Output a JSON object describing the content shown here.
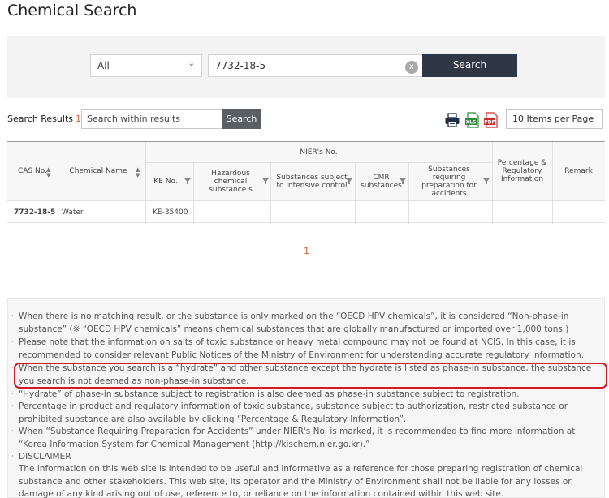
{
  "page": {
    "title": "Chemical Search"
  },
  "search": {
    "category_value": "All",
    "query_value": "7732-18-5",
    "clear_label": "x",
    "button_label": "Search"
  },
  "results": {
    "label": "Search Results",
    "count": "1",
    "within_placeholder": "Search within results",
    "within_button": "Search",
    "per_page": "10 Items per Page",
    "export": {
      "print": "print-icon",
      "excel": "XLS",
      "pdf": "PDF"
    }
  },
  "table": {
    "group_header": "NIER's No.",
    "headers": {
      "cas": "CAS No.",
      "name": "Chemical Name",
      "ke": "KE No.",
      "hazardous": "Hazardous chemical substance s",
      "intensive": "Substances subject to intensive control",
      "cmr": "CMR substances",
      "accidents": "Substances requiring preparation for accidents",
      "percentage": "Percentage & Regulatory Information",
      "remark": "Remark"
    },
    "rows": [
      {
        "cas": "7732-18-5",
        "name": "Water",
        "ke": "KE-35400"
      }
    ]
  },
  "pagination": {
    "current": "1"
  },
  "notices": [
    "When there is no matching result, or the substance is only marked on the “OECD HPV chemicals”, it is considered “Non-phase-in substance” (※ “OECD HPV chemicals” means chemical substances that are globally manufactured or imported over 1,000 tons.)",
    "Please note that the information on salts of toxic substance or heavy metal compound may not be found at NCIS. In this case, it is recommended to consider relevant Public Notices of the Ministry of Environment for understanding accurate regulatory information.",
    "When the substance you search is a “hydrate” and other substance except the hydrate is listed as phase-in substance, the substance you search is not deemed as non-phase-in substance.",
    "“Hydrate” of phase-in substance subject to registration is also deemed as phase-in substance subject to registration.",
    "Percentage in product and regulatory information of toxic substance, substance subject to authorization, restricted substance or prohibited substance are also available by clicking “Percentage & Regulatory Information”.",
    "When “Substance Requiring Preparation for Accidents” under NIER's No. is marked, it is recommended to find more information at “Korea Information System for Chemical Management (http://kischem.nier.go.kr).”",
    "DISCLAIMER"
  ],
  "disclaimer": "The information on this web site is intended to be useful and informative as a reference for those preparing registration of chemical substance and other stakeholders. This web site, its operator and the Ministry of Environment shall not be liable for any losses or damage of any kind arising out of use, reference to, or reliance on the information contained within this web site.",
  "colors": {
    "accent": "#d2612a",
    "button": "#2f3644",
    "highlight": "#d11a2a"
  }
}
